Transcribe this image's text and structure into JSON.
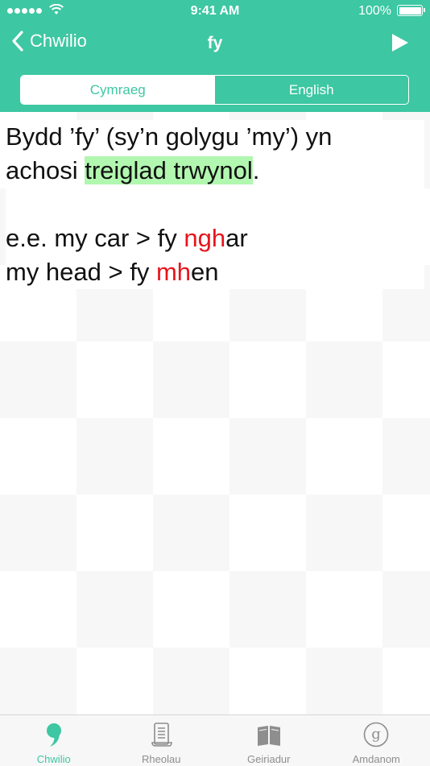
{
  "status": {
    "time": "9:41 AM",
    "battery": "100%"
  },
  "nav": {
    "back_label": "Chwilio",
    "title": "fy"
  },
  "segmented": {
    "left": "Cymraeg",
    "right": "English",
    "selected": "Cymraeg"
  },
  "content": {
    "line1": "Bydd ’fy’ (sy’n golygu ’my’) yn",
    "line2_prefix": "achosi ",
    "line2_highlight": "treiglad trwynol",
    "line2_suffix": ".",
    "ex1_prefix": "e.e. my car > fy ",
    "ex1_red": "ngh",
    "ex1_suffix": "ar",
    "ex2_prefix": "my head > fy ",
    "ex2_red": "mh",
    "ex2_suffix": "en"
  },
  "tabs": [
    {
      "label": "Chwilio",
      "icon": "comma-icon"
    },
    {
      "label": "Rheolau",
      "icon": "scroll-icon"
    },
    {
      "label": "Geiriadur",
      "icon": "book-icon"
    },
    {
      "label": "Amdanom",
      "icon": "g-circle-icon"
    }
  ],
  "colors": {
    "accent": "#3dc7a3",
    "highlight": "#b2f7b0",
    "mutation": "#e8141b"
  }
}
